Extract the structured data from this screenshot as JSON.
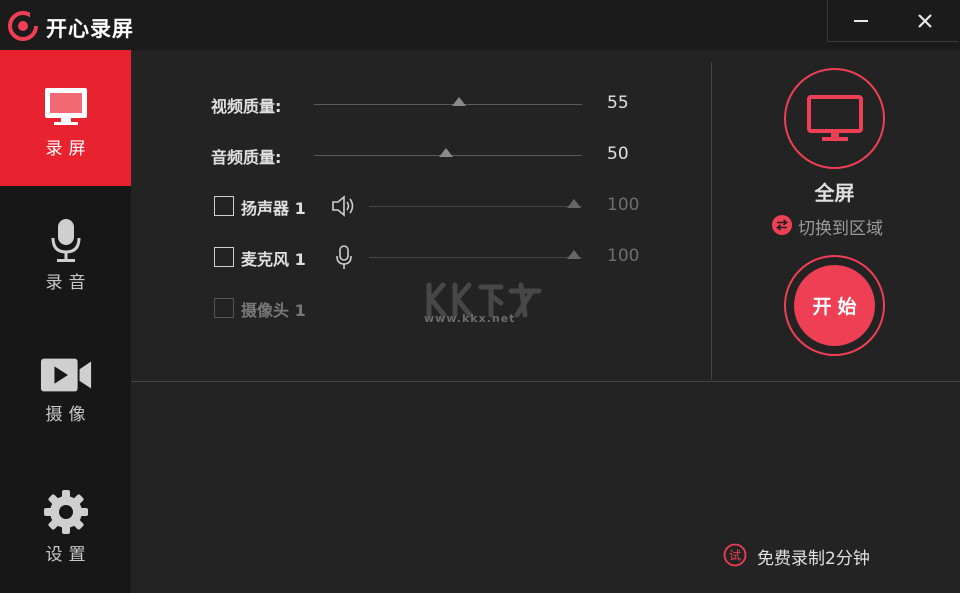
{
  "app": {
    "title": "开心录屏",
    "accent_color": "#e8232f",
    "button_color": "#ee3f55"
  },
  "window_controls": {
    "minimize_icon": "minimize-icon",
    "close_icon": "close-icon"
  },
  "sidebar": {
    "items": [
      {
        "label": "录屏",
        "icon": "monitor-icon",
        "active": true
      },
      {
        "label": "录音",
        "icon": "microphone-icon",
        "active": false
      },
      {
        "label": "摄像",
        "icon": "video-camera-icon",
        "active": false
      },
      {
        "label": "设置",
        "icon": "gear-icon",
        "active": false
      }
    ]
  },
  "settings": {
    "video_quality": {
      "label": "视频质量:",
      "value": "55"
    },
    "audio_quality": {
      "label": "音频质量:",
      "value": "50"
    },
    "speaker": {
      "label": "扬声器 1",
      "value": "100",
      "checked": false,
      "icon": "speaker-icon"
    },
    "microphone": {
      "label": "麦克风 1",
      "value": "100",
      "checked": false,
      "icon": "mic-icon"
    },
    "camera": {
      "label": "摄像头 1",
      "checked": false,
      "disabled": true
    }
  },
  "watermark": {
    "text": "www.kkx.net"
  },
  "capture": {
    "mode_label": "全屏",
    "switch_label": "切换到区域",
    "start_label": "开始"
  },
  "trial": {
    "icon_text": "试",
    "label": "免费录制2分钟"
  }
}
